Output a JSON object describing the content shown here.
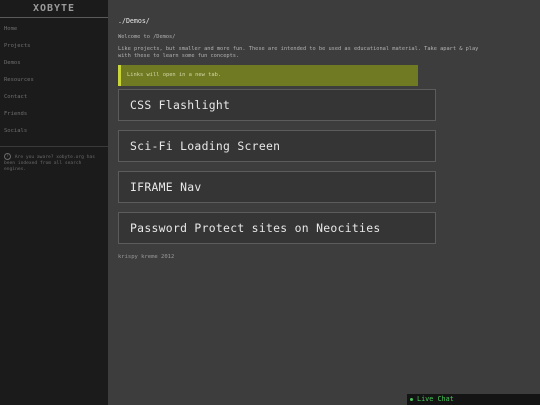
{
  "site": {
    "logo": "XOBYTE"
  },
  "sidebar": {
    "items": [
      {
        "label": "Home"
      },
      {
        "label": "Projects"
      },
      {
        "label": "Demos"
      },
      {
        "label": "Resources"
      },
      {
        "label": "Contact"
      },
      {
        "label": "Friends"
      },
      {
        "label": "Socials"
      }
    ],
    "note": "Are you aware? xobyte.org has been indexed from all search engines."
  },
  "main": {
    "breadcrumb": "./Demos/",
    "welcome": "Welcome to /Demos/",
    "description": "Like projects, but smaller and more fun. These are intended to be used as educational material. Take apart & play with these to learn some fun concepts.",
    "notice": "Links will open in a new tab.",
    "cards": [
      {
        "title": "CSS Flashlight"
      },
      {
        "title": "Sci-Fi Loading Screen"
      },
      {
        "title": "IFRAME Nav"
      },
      {
        "title": "Password Protect sites on Neocities"
      }
    ],
    "footer": "krispy kreme 2012"
  },
  "chat": {
    "label": "Live Chat",
    "status_color": "#46c85a"
  },
  "colors": {
    "notice_bg": "#707a23",
    "notice_border": "#c8d63a",
    "sidebar_bg": "#1b1b1b",
    "page_bg": "#3d3d3d"
  }
}
